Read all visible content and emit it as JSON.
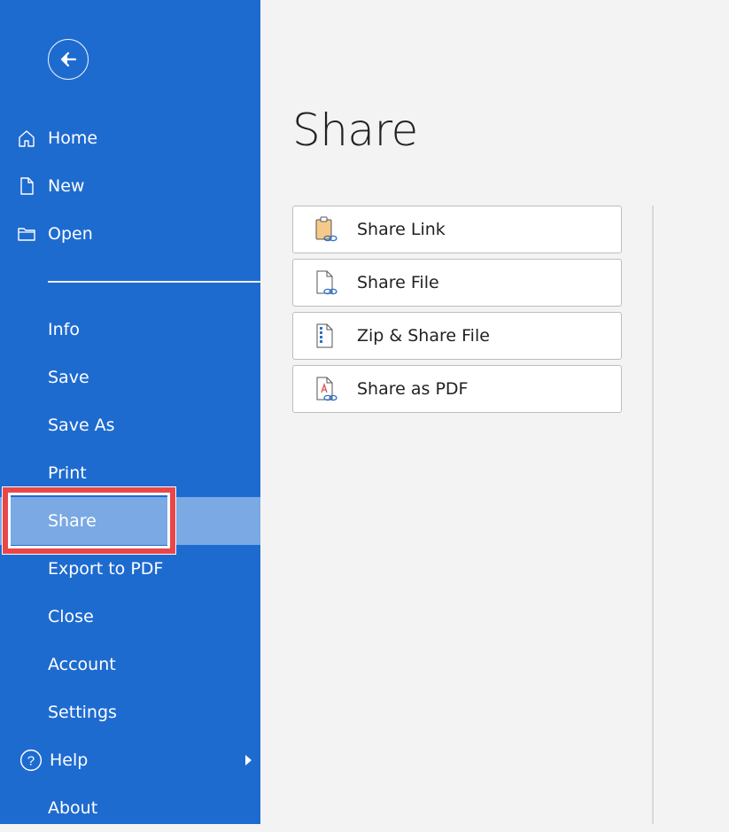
{
  "sidebar": {
    "back_label": "Back",
    "top_items": [
      {
        "label": "Home",
        "icon": "home-icon"
      },
      {
        "label": "New",
        "icon": "new-document-icon"
      },
      {
        "label": "Open",
        "icon": "folder-icon"
      }
    ],
    "items": [
      {
        "label": "Info"
      },
      {
        "label": "Save"
      },
      {
        "label": "Save As"
      },
      {
        "label": "Print"
      },
      {
        "label": "Share",
        "selected": true
      },
      {
        "label": "Export to PDF"
      },
      {
        "label": "Close"
      },
      {
        "label": "Account"
      },
      {
        "label": "Settings"
      },
      {
        "label": "Help",
        "icon": "help-icon",
        "has_submenu": true
      },
      {
        "label": "About"
      }
    ]
  },
  "main": {
    "title": "Share",
    "options": [
      {
        "label": "Share Link",
        "icon": "share-link-icon"
      },
      {
        "label": "Share File",
        "icon": "share-file-icon"
      },
      {
        "label": "Zip & Share File",
        "icon": "zip-share-icon"
      },
      {
        "label": "Share as PDF",
        "icon": "share-pdf-icon"
      }
    ]
  },
  "colors": {
    "sidebar_bg": "#1e6bd0",
    "selected_bg": "#7aa9e4",
    "highlight": "#e8474a",
    "main_bg": "#f3f3f3"
  }
}
